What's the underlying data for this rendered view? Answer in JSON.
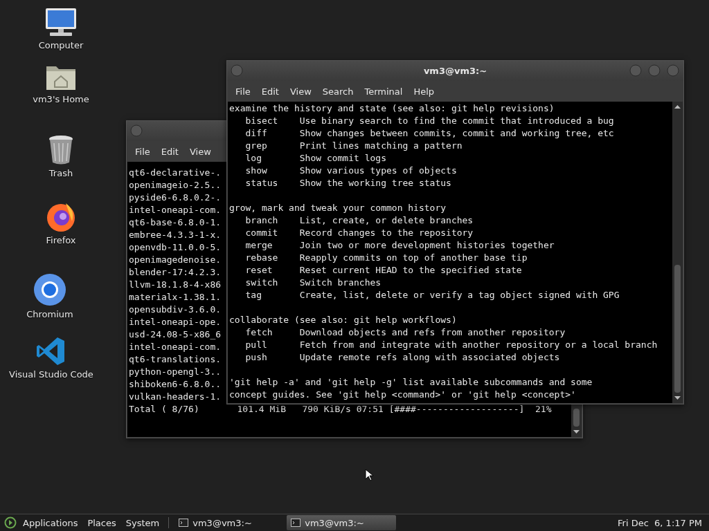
{
  "desktop_icons": [
    {
      "kind": "computer",
      "label": "Computer"
    },
    {
      "kind": "home",
      "label": "vm3's Home"
    },
    {
      "kind": "trash",
      "label": "Trash"
    },
    {
      "kind": "firefox",
      "label": "Firefox"
    },
    {
      "kind": "chromium",
      "label": "Chromium"
    },
    {
      "kind": "vscode",
      "label": "Visual Studio Code"
    }
  ],
  "windows": [
    {
      "menu": [
        "File",
        "Edit",
        "View"
      ],
      "sections": [
        [
          "qt6-declarative-.",
          "openimageio-2.5..",
          "pyside6-6.8.0.2-.",
          "intel-oneapi-com.",
          "qt6-base-6.8.0-1.",
          "embree-4.3.3-1-x.",
          "openvdb-11.0.0-5.",
          "openimagedenoise.",
          "blender-17:4.2.3.",
          "llvm-18.1.8-4-x86",
          "materialx-1.38.1.",
          "opensubdiv-3.6.0.",
          "intel-oneapi-ope.",
          "usd-24.08-5-x86_6",
          "intel-oneapi-com.",
          "qt6-translations.",
          "python-opengl-3..",
          "shiboken6-6.8.0..",
          "vulkan-headers-1.",
          "Total ( 8/76)       101.4 MiB   790 KiB/s 07:51 [####-------------------]  21%"
        ]
      ]
    },
    {
      "title": "vm3@vm3:~",
      "menu": [
        "File",
        "Edit",
        "View",
        "Search",
        "Terminal",
        "Help"
      ],
      "sections": [
        [
          "examine the history and state (see also: git help revisions)",
          "   bisect    Use binary search to find the commit that introduced a bug",
          "   diff      Show changes between commits, commit and working tree, etc",
          "   grep      Print lines matching a pattern",
          "   log       Show commit logs",
          "   show      Show various types of objects",
          "   status    Show the working tree status"
        ],
        [
          "grow, mark and tweak your common history",
          "   branch    List, create, or delete branches",
          "   commit    Record changes to the repository",
          "   merge     Join two or more development histories together",
          "   rebase    Reapply commits on top of another base tip",
          "   reset     Reset current HEAD to the specified state",
          "   switch    Switch branches",
          "   tag       Create, list, delete or verify a tag object signed with GPG"
        ],
        [
          "collaborate (see also: git help workflows)",
          "   fetch     Download objects and refs from another repository",
          "   pull      Fetch from and integrate with another repository or a local branch",
          "   push      Update remote refs along with associated objects"
        ],
        [
          "'git help -a' and 'git help -g' list available subcommands and some",
          "concept guides. See 'git help <command>' or 'git help <concept>'"
        ]
      ]
    }
  ],
  "taskbar": {
    "menus": [
      "Applications",
      "Places",
      "System"
    ],
    "windows": [
      {
        "label": "vm3@vm3:~",
        "selected": false
      },
      {
        "label": "vm3@vm3:~",
        "selected": true
      }
    ],
    "clock": "Fri Dec  6, 1:17 PM"
  }
}
